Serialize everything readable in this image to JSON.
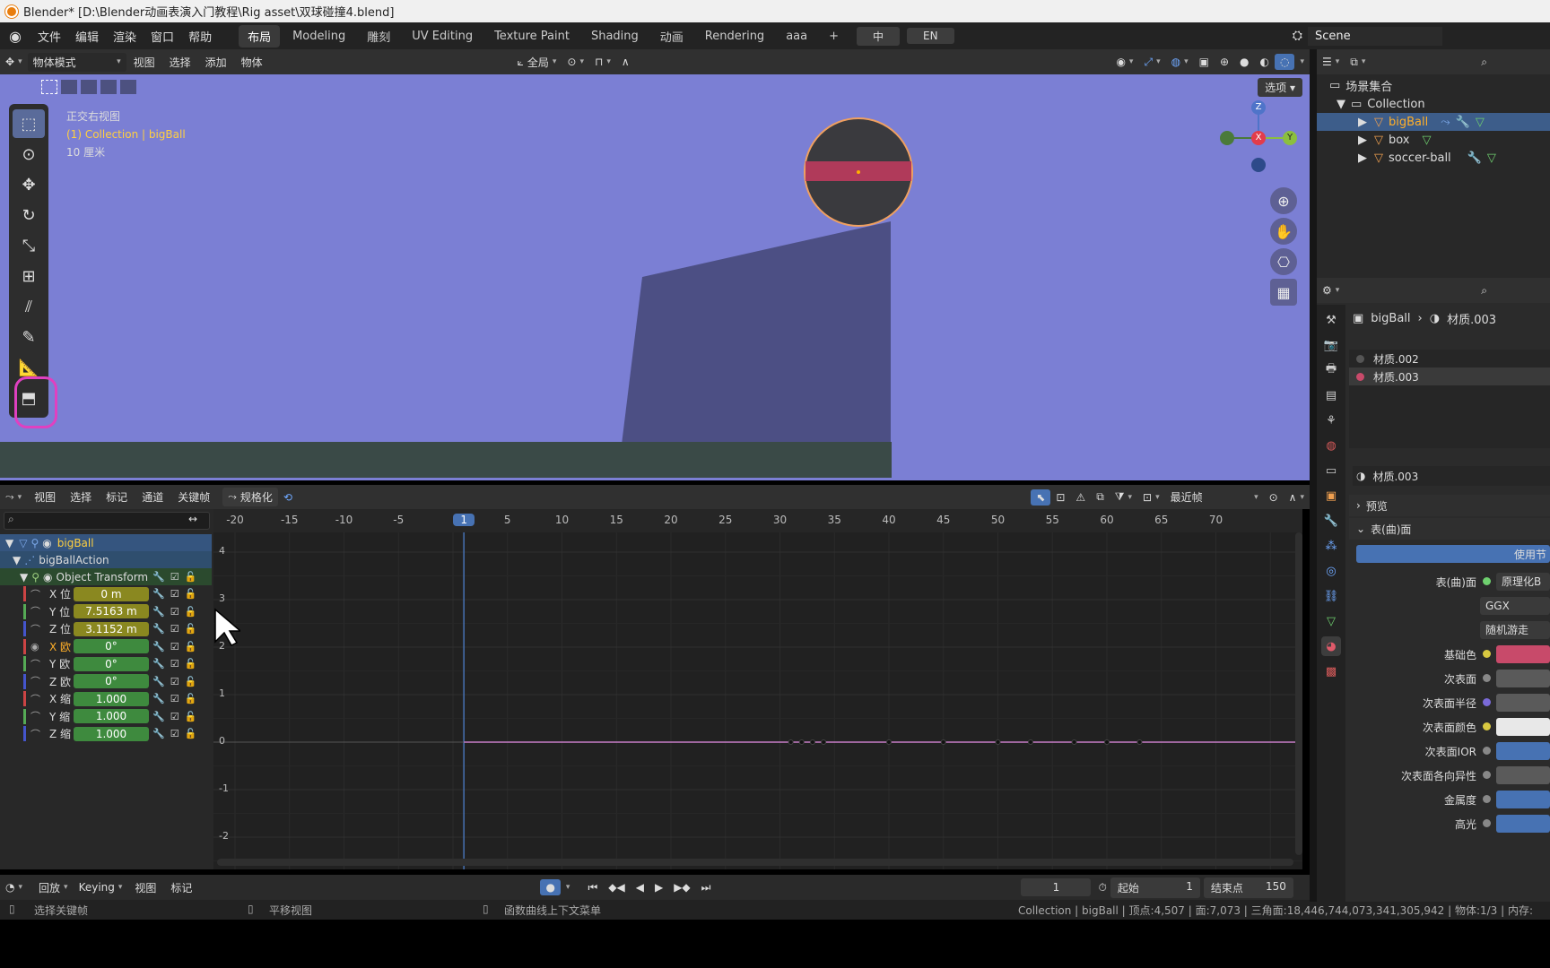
{
  "window": {
    "title": "Blender* [D:\\Blender动画表演入门教程\\Rig asset\\双球碰撞4.blend]"
  },
  "menu": {
    "items": [
      "文件",
      "编辑",
      "渲染",
      "窗口",
      "帮助"
    ]
  },
  "workspaces": [
    "布局",
    "Modeling",
    "雕刻",
    "UV Editing",
    "Texture Paint",
    "Shading",
    "动画",
    "Rendering",
    "aaa"
  ],
  "lang": {
    "zh": "中",
    "en": "EN"
  },
  "scene": {
    "name": "Scene"
  },
  "viewport_header": {
    "mode": "物体模式",
    "menus": [
      "视图",
      "选择",
      "添加",
      "物体"
    ],
    "orientation": "全局",
    "options": "选项"
  },
  "viewport": {
    "view_name": "正交右视图",
    "collection_line": "(1) Collection | bigBall",
    "scale": "10 厘米",
    "gizmo": {
      "z": "Z",
      "x": "X",
      "y": "Y"
    }
  },
  "graph_header": {
    "menus": [
      "视图",
      "选择",
      "标记",
      "通道",
      "关键帧"
    ],
    "normalize": "规格化",
    "pivot": "最近帧"
  },
  "ruler": {
    "ticks": [
      "-20",
      "-15",
      "-10",
      "-5",
      "1",
      "5",
      "10",
      "15",
      "20",
      "25",
      "30",
      "35",
      "40",
      "45",
      "50",
      "55",
      "60",
      "65",
      "70"
    ],
    "current_frame": "1"
  },
  "graph_y_ticks": [
    "4",
    "3",
    "2",
    "1",
    "0",
    "-1",
    "-2"
  ],
  "channels": {
    "object": "bigBall",
    "action": "bigBallAction",
    "group": "Object Transform",
    "rows": [
      {
        "label": "X 位",
        "value": "0 m"
      },
      {
        "label": "Y 位",
        "value": "7.5163 m"
      },
      {
        "label": "Z 位",
        "value": "3.1152 m"
      },
      {
        "label": "X 欧",
        "value": "0°"
      },
      {
        "label": "Y 欧",
        "value": "0°"
      },
      {
        "label": "Z 欧",
        "value": "0°"
      },
      {
        "label": "X 缩",
        "value": "1.000"
      },
      {
        "label": "Y 缩",
        "value": "1.000"
      },
      {
        "label": "Z 缩",
        "value": "1.000"
      }
    ]
  },
  "timeline": {
    "menus": [
      "回放",
      "Keying",
      "视图",
      "标记"
    ],
    "current": "1",
    "start_label": "起始",
    "start": "1",
    "end_label": "结束点",
    "end": "150"
  },
  "status": {
    "left1": "选择关键帧",
    "left2": "平移视图",
    "left3": "函数曲线上下文菜单",
    "right": "Collection | bigBall | 顶点:4,507 | 面:7,073 | 三角面:18,446,744,073,341,305,942 | 物体:1/3 | 内存:"
  },
  "outliner": {
    "root": "场景集合",
    "collection": "Collection",
    "items": [
      "bigBall",
      "box",
      "soccer-ball"
    ]
  },
  "properties": {
    "breadcrumb_obj": "bigBall",
    "breadcrumb_mat": "材质.003",
    "slots": [
      "材质.002",
      "材质.003"
    ],
    "material_name": "材质.003",
    "preview": "预览",
    "surface_panel": "表(曲)面",
    "use_nodes": "使用节",
    "rows": [
      {
        "label": "表(曲)面",
        "value": "原理化B"
      },
      {
        "label": "",
        "value": "GGX"
      },
      {
        "label": "",
        "value": "随机游走"
      },
      {
        "label": "基础色",
        "value": ""
      },
      {
        "label": "次表面",
        "value": ""
      },
      {
        "label": "次表面半径",
        "value": ""
      },
      {
        "label": "次表面颜色",
        "value": ""
      },
      {
        "label": "次表面IOR",
        "value": ""
      },
      {
        "label": "次表面各向异性",
        "value": ""
      },
      {
        "label": "金属度",
        "value": ""
      },
      {
        "label": "高光",
        "value": ""
      }
    ]
  },
  "colors": {
    "viewport_bg": "#7b7fd4",
    "accent_blue": "#4772b3",
    "selected_text": "#ffaf29",
    "material_red": "#c84a6a"
  }
}
